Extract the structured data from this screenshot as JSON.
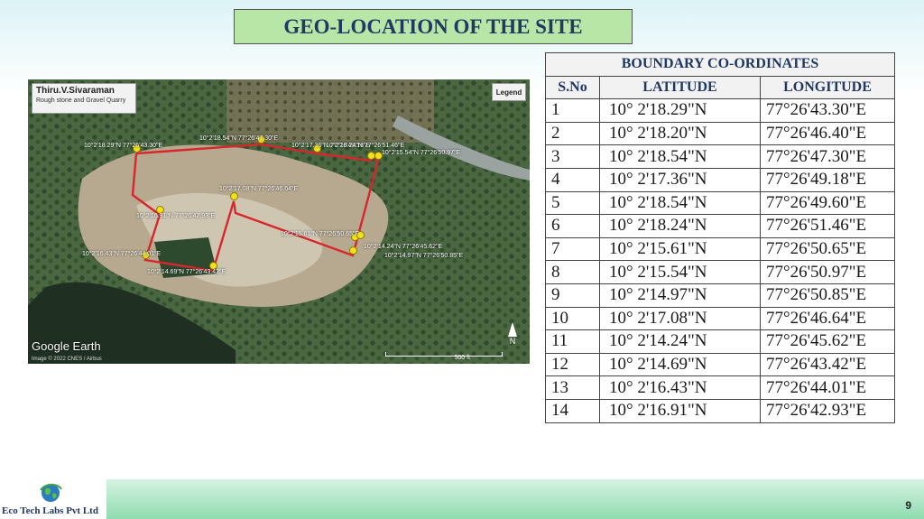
{
  "slide": {
    "title": "GEO-LOCATION OF THE SITE",
    "page_number": "9"
  },
  "map": {
    "owner_name": "Thiru.V.Sivaraman",
    "owner_desc": "Rough stone and Gravel Quarry",
    "legend_label": "Legend",
    "provider": "Google Earth",
    "copyright": "Image © 2022 CNES / Airbus",
    "scale_label": "500 ft",
    "north_label": "N",
    "point_labels": [
      "10°2'18.29\"N 77°26'43.30\"E",
      "10°2'18.54\"N 77°26'47.30\"E",
      "10°2'17.36\"N 77°26'49.18\"E",
      "10°2'18.24\"N 77°26'51.46\"E",
      "10°2'15.54\"N 77°26'50.97\"E",
      "10°2'14.97\"N 77°26'50.85\"E",
      "10°2'15.61\"N 77°26'50.65\"E",
      "10°2'14.24\"N 77°26'45.62\"E",
      "10°2'14.69\"N 77°26'43.42\"E",
      "10°2'16.43\"N 77°26'44.01\"E",
      "10°2'16.91\"N 77°26'42.93\"E",
      "10°2'17.08\"N 77°26'46.64\"E"
    ]
  },
  "table": {
    "caption": "BOUNDARY CO-ORDINATES",
    "headers": [
      "S.No",
      "LATITUDE",
      "LONGITUDE"
    ],
    "rows": [
      [
        "1",
        "10° 2'18.29\"N",
        "77°26'43.30\"E"
      ],
      [
        "2",
        "10° 2'18.20\"N",
        "77°26'46.40\"E"
      ],
      [
        "3",
        "10° 2'18.54\"N",
        "77°26'47.30\"E"
      ],
      [
        "4",
        "10° 2'17.36\"N",
        "77°26'49.18\"E"
      ],
      [
        "5",
        "10° 2'18.54\"N",
        "77°26'49.60\"E"
      ],
      [
        "6",
        "10° 2'18.24\"N",
        "77°26'51.46\"E"
      ],
      [
        "7",
        "10° 2'15.61\"N",
        "77°26'50.65\"E"
      ],
      [
        "8",
        "10° 2'15.54\"N",
        "77°26'50.97\"E"
      ],
      [
        "9",
        "10° 2'14.97\"N",
        "77°26'50.85\"E"
      ],
      [
        "10",
        "10° 2'17.08\"N",
        "77°26'46.64\"E"
      ],
      [
        "11",
        "10° 2'14.24\"N",
        "77°26'45.62\"E"
      ],
      [
        "12",
        "10° 2'14.69\"N",
        "77°26'43.42\"E"
      ],
      [
        "13",
        "10° 2'16.43\"N",
        "77°26'44.01\"E"
      ],
      [
        "14",
        "10° 2'16.91\"N",
        "77°26'42.93\"E"
      ]
    ]
  },
  "footer": {
    "brand": "Eco Tech Labs Pvt Ltd"
  },
  "colors": {
    "title_bg": "#b8e6a6",
    "title_text": "#1f3864",
    "boundary_line": "#d9262b",
    "pin": "#f4e11c",
    "footer_green": "#8fdcb0"
  }
}
